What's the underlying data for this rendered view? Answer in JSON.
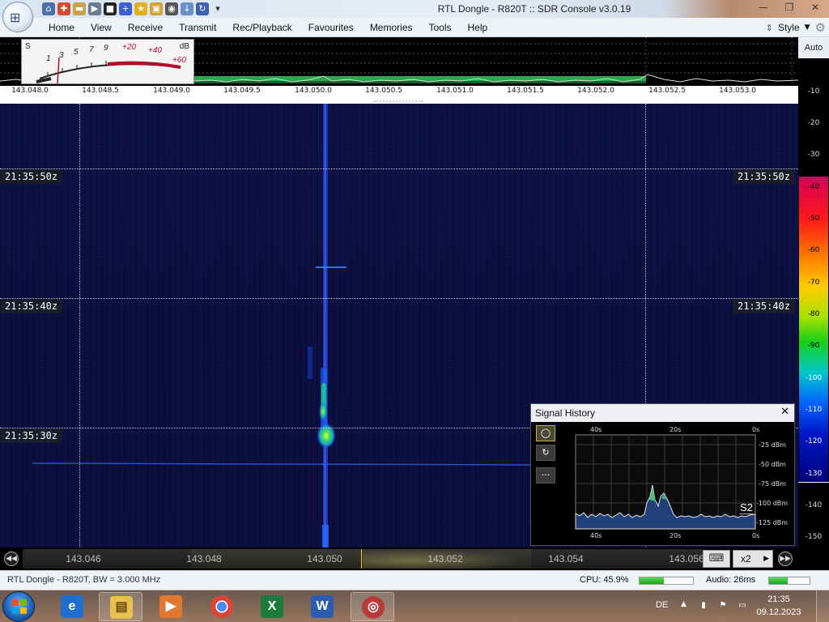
{
  "window": {
    "title": "RTL Dongle - R820T :: SDR Console v3.0.19",
    "minimize": "—",
    "maximize": "❐",
    "close": "✕"
  },
  "menu": {
    "items": [
      "Home",
      "View",
      "Receive",
      "Transmit",
      "Rec/Playback",
      "Favourites",
      "Memories",
      "Tools",
      "Help"
    ],
    "style_label": "Style"
  },
  "smeter": {
    "s_label": "S",
    "db_label": "dB",
    "s_scale": [
      "1",
      "3",
      "5",
      "7",
      "9"
    ],
    "plus_scale": [
      "+20",
      "+40",
      "+60"
    ]
  },
  "spectrum": {
    "freq_ticks": [
      "143.048.0",
      "143.048.5",
      "143.049.0",
      "143.049.5",
      "143.050.0",
      "143.050.5",
      "143.051.0",
      "143.051.5",
      "143.052.0",
      "143.052.5",
      "143.053.0"
    ]
  },
  "waterfall": {
    "timestamps": [
      "21:35:50z",
      "21:35:40z",
      "21:35:30z"
    ]
  },
  "db_scale": {
    "auto_label": "Auto",
    "ticks": [
      "-10",
      "-20",
      "-30",
      "-40",
      "-50",
      "-60",
      "-70",
      "-80",
      "-90",
      "-100",
      "-110",
      "-120",
      "-130",
      "-140",
      "-150"
    ]
  },
  "signal_history": {
    "title": "Signal History",
    "close": "✕",
    "time_labels": [
      "40s",
      "20s",
      "0s"
    ],
    "dbm_labels": [
      "-25 dBm",
      "-50 dBm",
      "-75 dBm",
      "-100 dBm",
      "-125 dBm"
    ],
    "s_reading": "S2",
    "buttons": [
      "◯",
      "↻",
      "···"
    ]
  },
  "tuning": {
    "ticks": [
      "143.046",
      "143.048",
      "143.050",
      "143.052",
      "143.054",
      "143.056"
    ],
    "zoom": "x2",
    "keyboard_icon": "⌨"
  },
  "status": {
    "device": "RTL Dongle - R820T, BW = 3.000 MHz",
    "cpu": "CPU: 45.9%",
    "cpu_percent": 45.9,
    "audio": "Audio: 26ms",
    "audio_level": 0.45
  },
  "taskbar": {
    "apps": [
      "internet-explorer",
      "file-explorer",
      "media-player",
      "chrome",
      "excel",
      "word",
      "sdr-console"
    ],
    "language": "DE",
    "time": "21:35",
    "date": "09.12.2023"
  },
  "colors": {
    "waterfall_bg": "#0a0c33",
    "signal_green": "#2aa84b",
    "accent_blue": "#1b5fb5"
  }
}
